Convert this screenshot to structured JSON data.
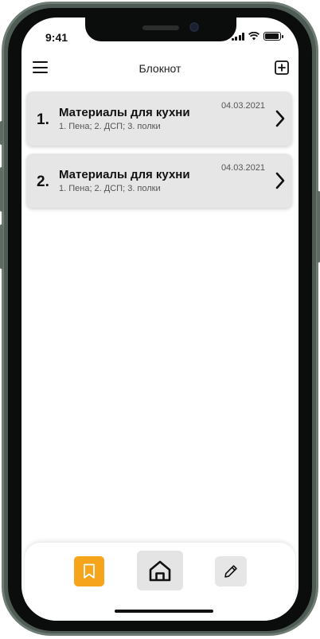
{
  "status_bar": {
    "time": "9:41"
  },
  "header": {
    "title": "Блокнот",
    "menu_icon": "hamburger-menu-icon",
    "add_icon": "plus-square-icon"
  },
  "notes": [
    {
      "number": "1.",
      "title": "Материалы для кухни",
      "summary": "1. Пена; 2. ДСП; 3. полки",
      "date": "04.03.2021"
    },
    {
      "number": "2.",
      "title": "Материалы для кухни",
      "summary": "1. Пена; 2. ДСП; 3. полки",
      "date": "04.03.2021"
    }
  ],
  "bottom_nav": {
    "items": [
      {
        "icon": "bookmark-icon",
        "active": true
      },
      {
        "icon": "home-icon",
        "active": false
      },
      {
        "icon": "pencil-icon",
        "active": false
      }
    ],
    "accent_color": "#f5a41c"
  }
}
